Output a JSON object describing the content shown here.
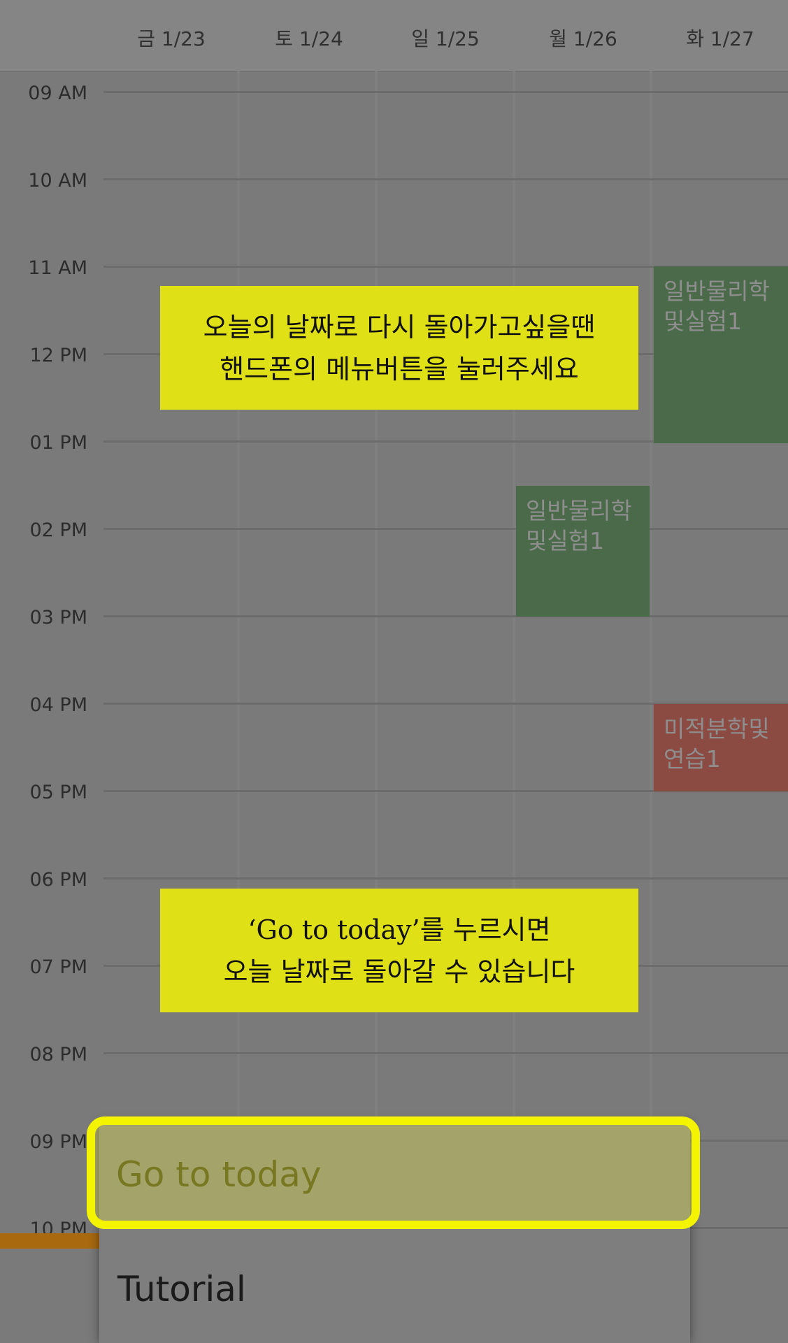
{
  "days": [
    "금 1/23",
    "토 1/24",
    "일 1/25",
    "월 1/26",
    "화 1/27"
  ],
  "hours": [
    "09 AM",
    "10 AM",
    "11 AM",
    "12 PM",
    "01 PM",
    "02 PM",
    "03 PM",
    "04 PM",
    "05 PM",
    "06 PM",
    "07 PM",
    "08 PM",
    "09 PM",
    "10 PM"
  ],
  "events": [
    {
      "title": "일반물리학\n및실험1",
      "color": "#4a6a4a"
    },
    {
      "title": "일반물리학\n및실험1",
      "color": "#4a6a4a"
    },
    {
      "title": "미적분학및\n연습1",
      "color": "#8b4a42"
    }
  ],
  "notes": [
    {
      "line1": "오늘의 날짜로 다시 돌아가고싶을땐",
      "line2": "핸드폰의 메뉴버튼을 눌러주세요"
    },
    {
      "line1": "‘Go to today’를 누르시면",
      "line2": "오늘 날짜로 돌아갈 수 있습니다"
    }
  ],
  "menu": {
    "go_today": "Go to today",
    "tutorial": "Tutorial"
  },
  "colors": {
    "note_bg": "#e0e016",
    "highlight": "#f4f400",
    "now_line": "#a8690f"
  }
}
